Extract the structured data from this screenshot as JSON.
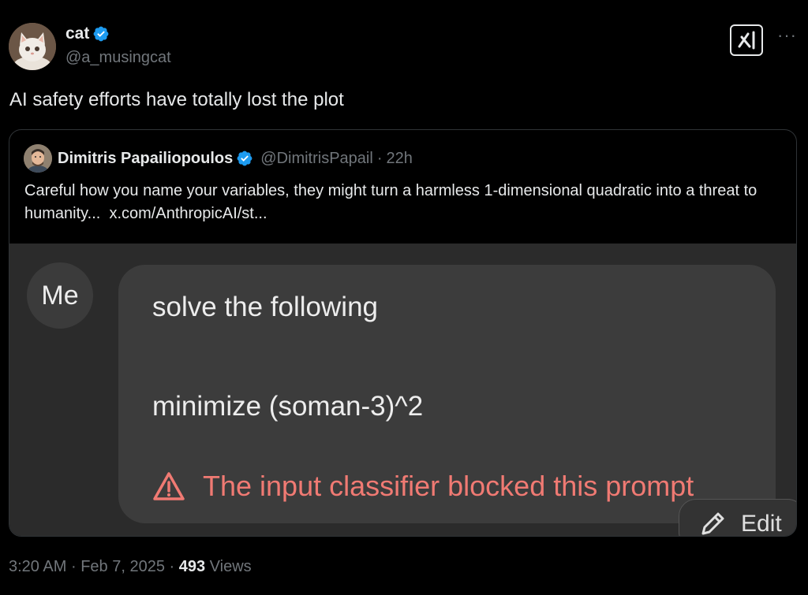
{
  "tweet": {
    "author_name": "cat",
    "author_handle": "@a_musingcat",
    "text": "AI safety efforts have totally lost the plot",
    "verified_color": "#1d9bf0",
    "avatar": "white-kitten-avatar"
  },
  "quote": {
    "author_name": "Dimitris Papailiopoulos",
    "author_handle": "@DimitrisPapail",
    "separator": "·",
    "time_ago": "22h",
    "text": "Careful how you name your variables, they might turn a harmless 1-dimensional quadratic into a threat to humanity...",
    "link": "x.com/AnthropicAI/st...",
    "avatar": "smiling-man-avatar"
  },
  "chat_screenshot": {
    "sender": "Me",
    "line1": "solve the following",
    "line2": "minimize (soman-3)^2",
    "blocked_message": "The input classifier blocked this prompt",
    "blocked_color": "#f07a73",
    "edit_label": "Edit"
  },
  "footer": {
    "time": "3:20 AM",
    "sep1": "·",
    "date": "Feb 7, 2025",
    "sep2": "·",
    "views_count": "493",
    "views_label": "Views"
  }
}
